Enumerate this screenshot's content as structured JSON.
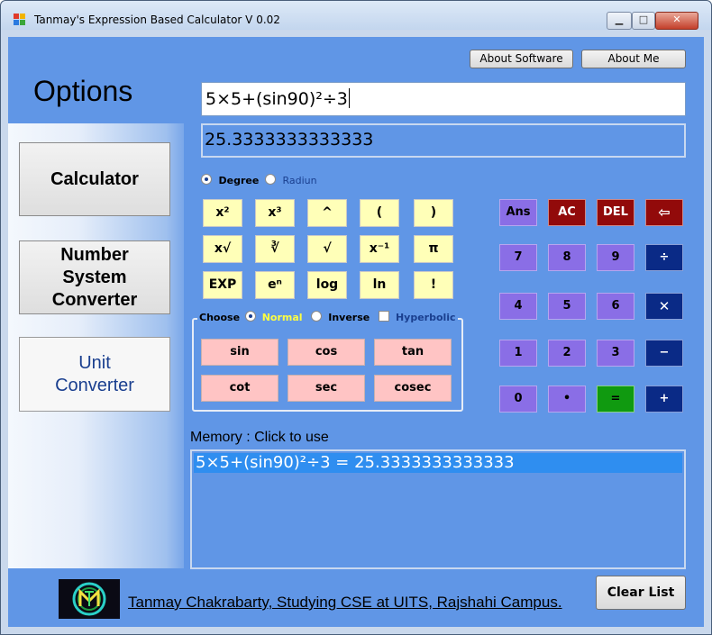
{
  "window": {
    "title": "Tanmay's Expression Based Calculator V 0.02",
    "minimize_glyph": "▁",
    "maximize_glyph": "□",
    "close_glyph": "✕"
  },
  "header": {
    "about_software": "About Software",
    "about_me": "About Me"
  },
  "sidebar": {
    "title": "Options",
    "calculator": "Calculator",
    "number_converter": [
      "Number",
      "System",
      "Converter"
    ],
    "unit_converter": [
      "Unit",
      "Converter"
    ]
  },
  "display": {
    "expression": "5×5+(sin90)²÷3",
    "result": "25.3333333333333"
  },
  "angle": {
    "degree": "Degree",
    "radian": "Radiun",
    "selected": "degree"
  },
  "functions": [
    [
      "x²",
      "x³",
      "^",
      "(",
      ")"
    ],
    [
      "x√",
      "∛",
      "√",
      "x⁻¹",
      "π"
    ],
    [
      "EXP",
      "eⁿ",
      "log",
      "ln",
      "!"
    ]
  ],
  "trig_mode": {
    "choose_label": "Choose",
    "normal": "Normal",
    "inverse": "Inverse",
    "hyperbolic": "Hyperbolic",
    "selected": "normal"
  },
  "trig": [
    [
      "sin",
      "cos",
      "tan"
    ],
    [
      "cot",
      "sec",
      "cosec"
    ]
  ],
  "keypad": {
    "row1": [
      "Ans",
      "AC",
      "DEL",
      "⇦"
    ],
    "row2": [
      "7",
      "8",
      "9",
      "÷"
    ],
    "row3": [
      "4",
      "5",
      "6",
      "✕"
    ],
    "row4": [
      "1",
      "2",
      "3",
      "−"
    ],
    "row5": [
      "0",
      "•",
      "=",
      "+"
    ]
  },
  "memory": {
    "label": "Memory : Click to use",
    "items": [
      "5×5+(sin90)²÷3 = 25.3333333333333"
    ]
  },
  "footer": {
    "credit": "Tanmay Chakrabarty, Studying CSE at UITS, Rajshahi Campus.",
    "clear_list": "Clear List"
  },
  "colors": {
    "background": "#6096e6",
    "function_button": "#ffffb8",
    "trig_button": "#ffc4c4",
    "digit_key": "#8a6ee6",
    "danger_key": "#920a0a",
    "operator_key": "#0a2a86",
    "equals_key": "#109a10",
    "memory_highlight": "#2f8ef0"
  }
}
